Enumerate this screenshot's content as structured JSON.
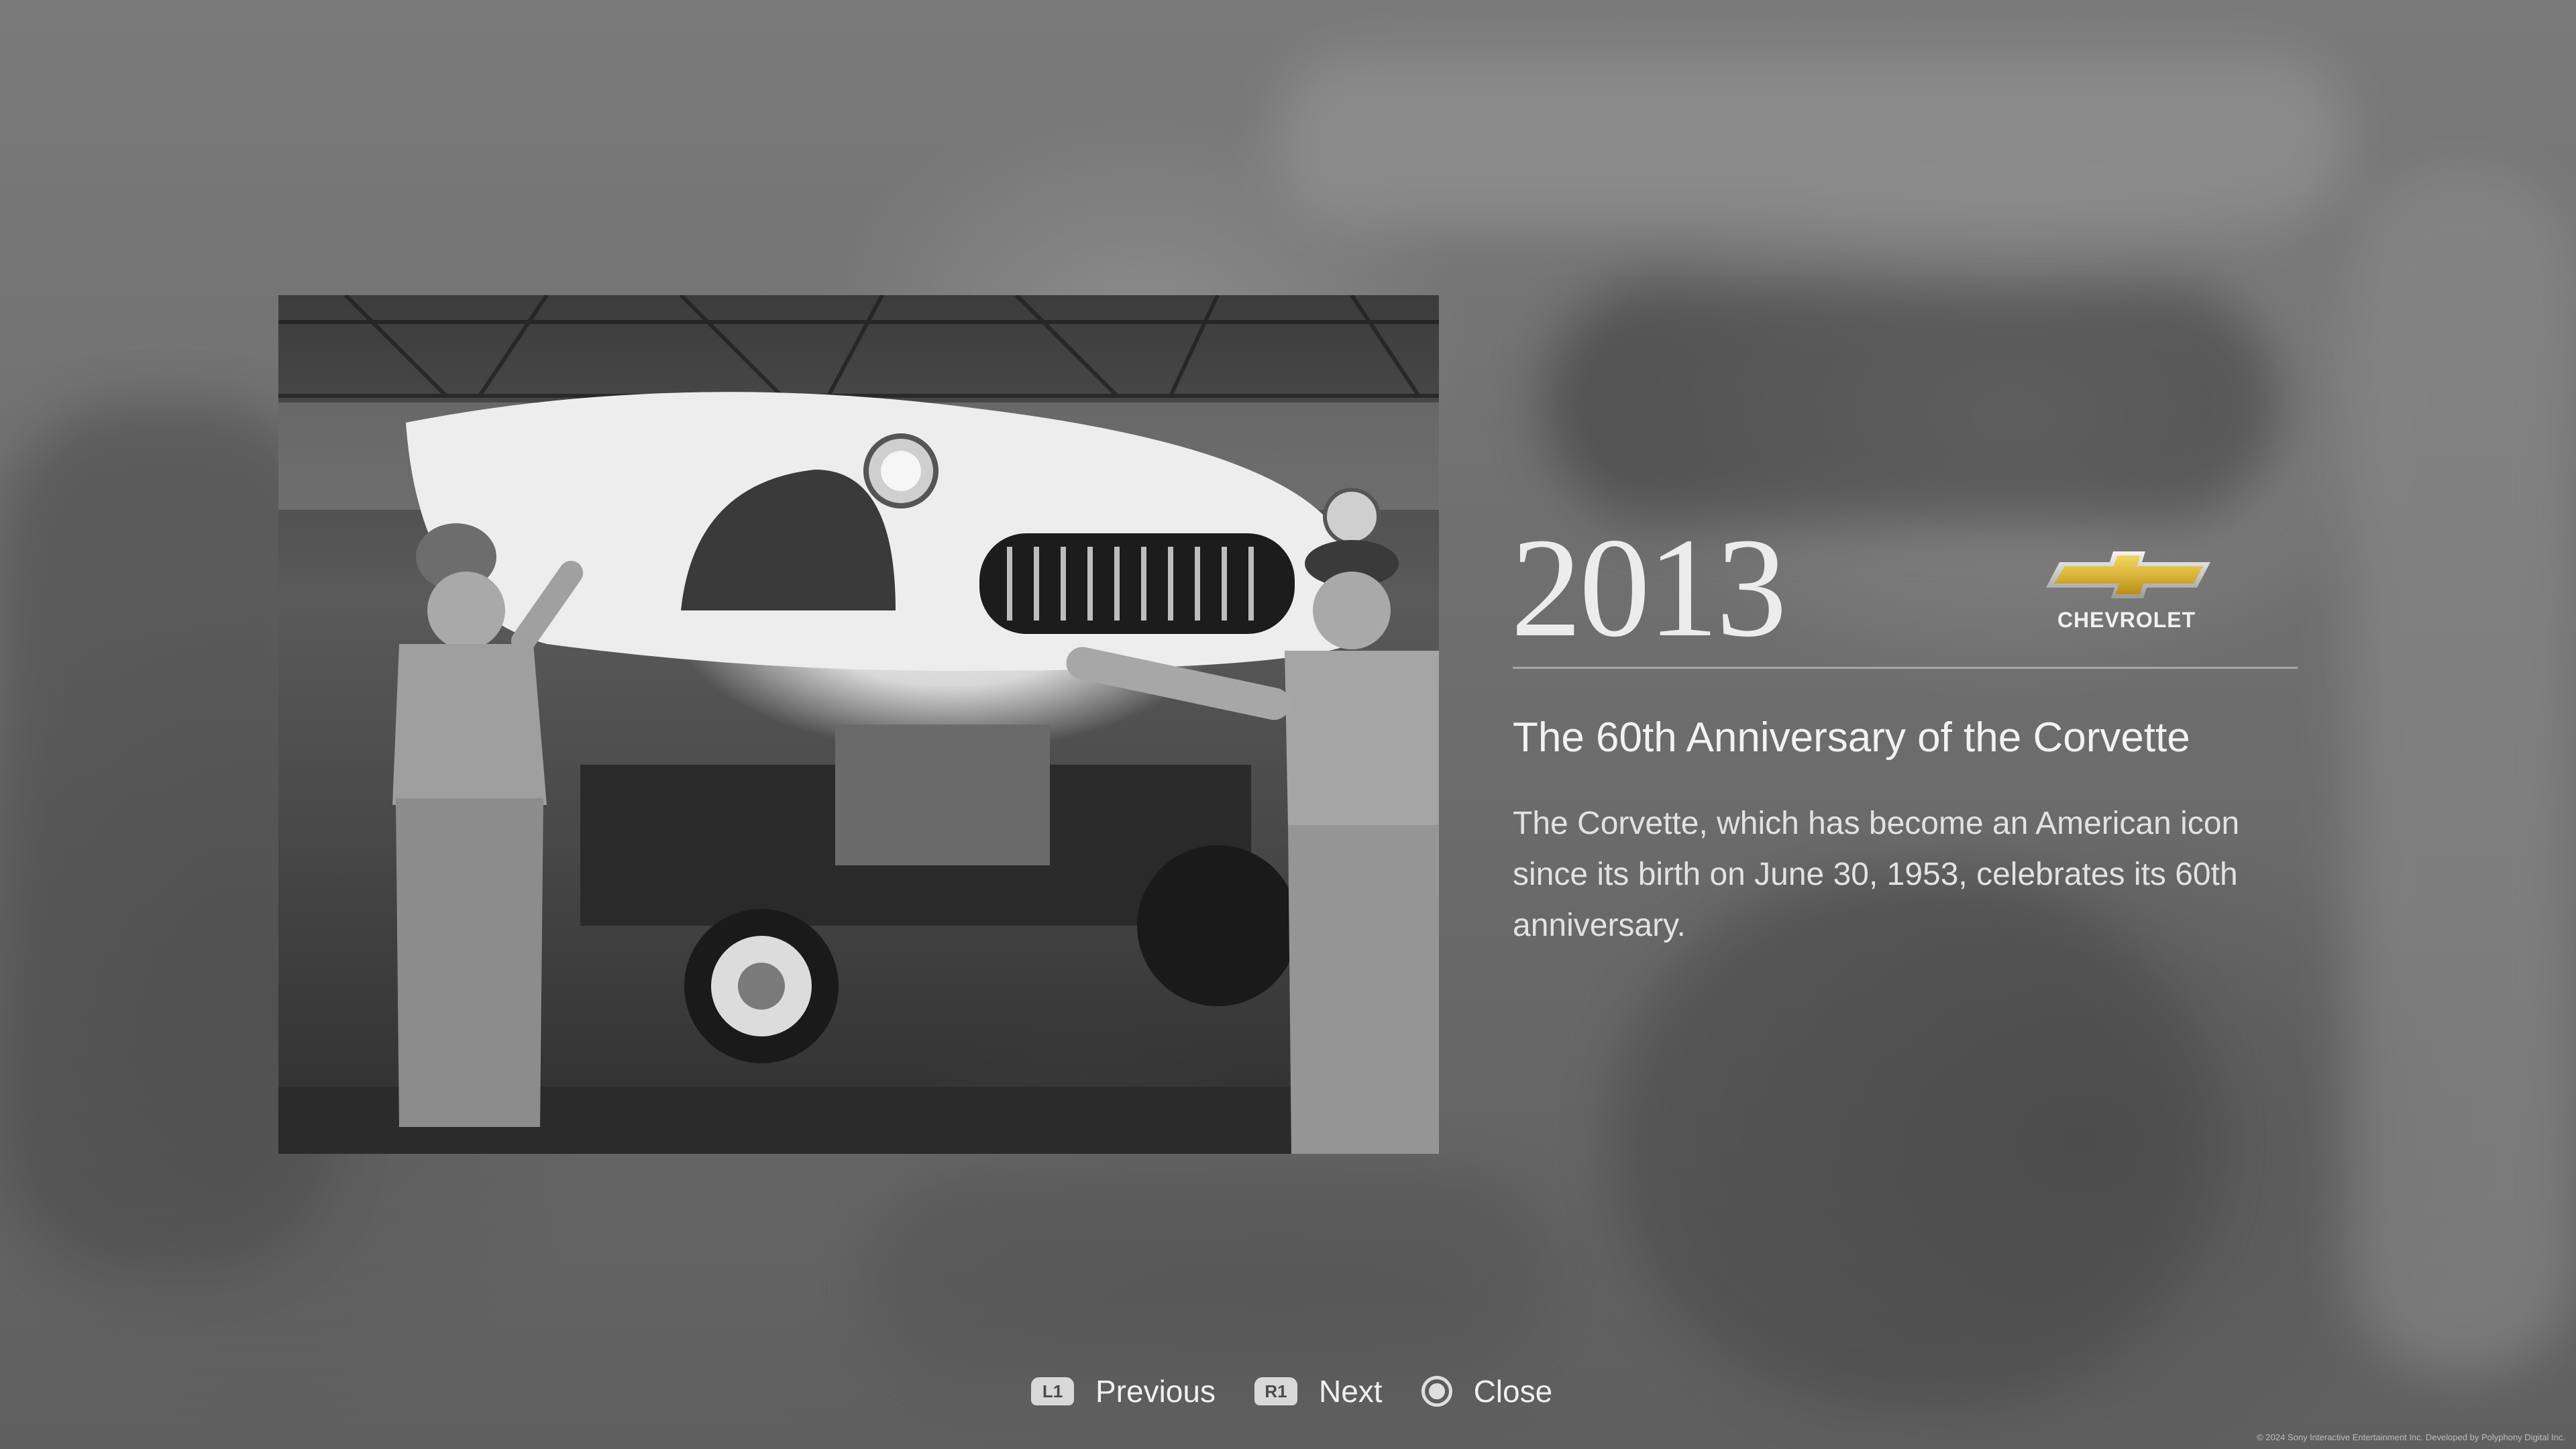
{
  "entry": {
    "year": "2013",
    "brand_name": "CHEVROLET",
    "headline": "The 60th Anniversary of the Corvette",
    "body": "The Corvette, which has become an American icon since its birth on June 30, 1953, celebrates its 60th anniversary."
  },
  "controls": {
    "previous_key": "L1",
    "previous_label": "Previous",
    "next_key": "R1",
    "next_label": "Next",
    "close_label": "Close"
  },
  "footer": {
    "legal": "© 2024 Sony Interactive Entertainment Inc. Developed by Polyphony Digital Inc."
  },
  "icons": {
    "brand": "chevrolet-bowtie-icon",
    "close": "circle-button-icon"
  },
  "colors": {
    "background": "#6f6f6f",
    "text_primary": "#f2f2f2",
    "brand_gold": "#d9b53a"
  }
}
